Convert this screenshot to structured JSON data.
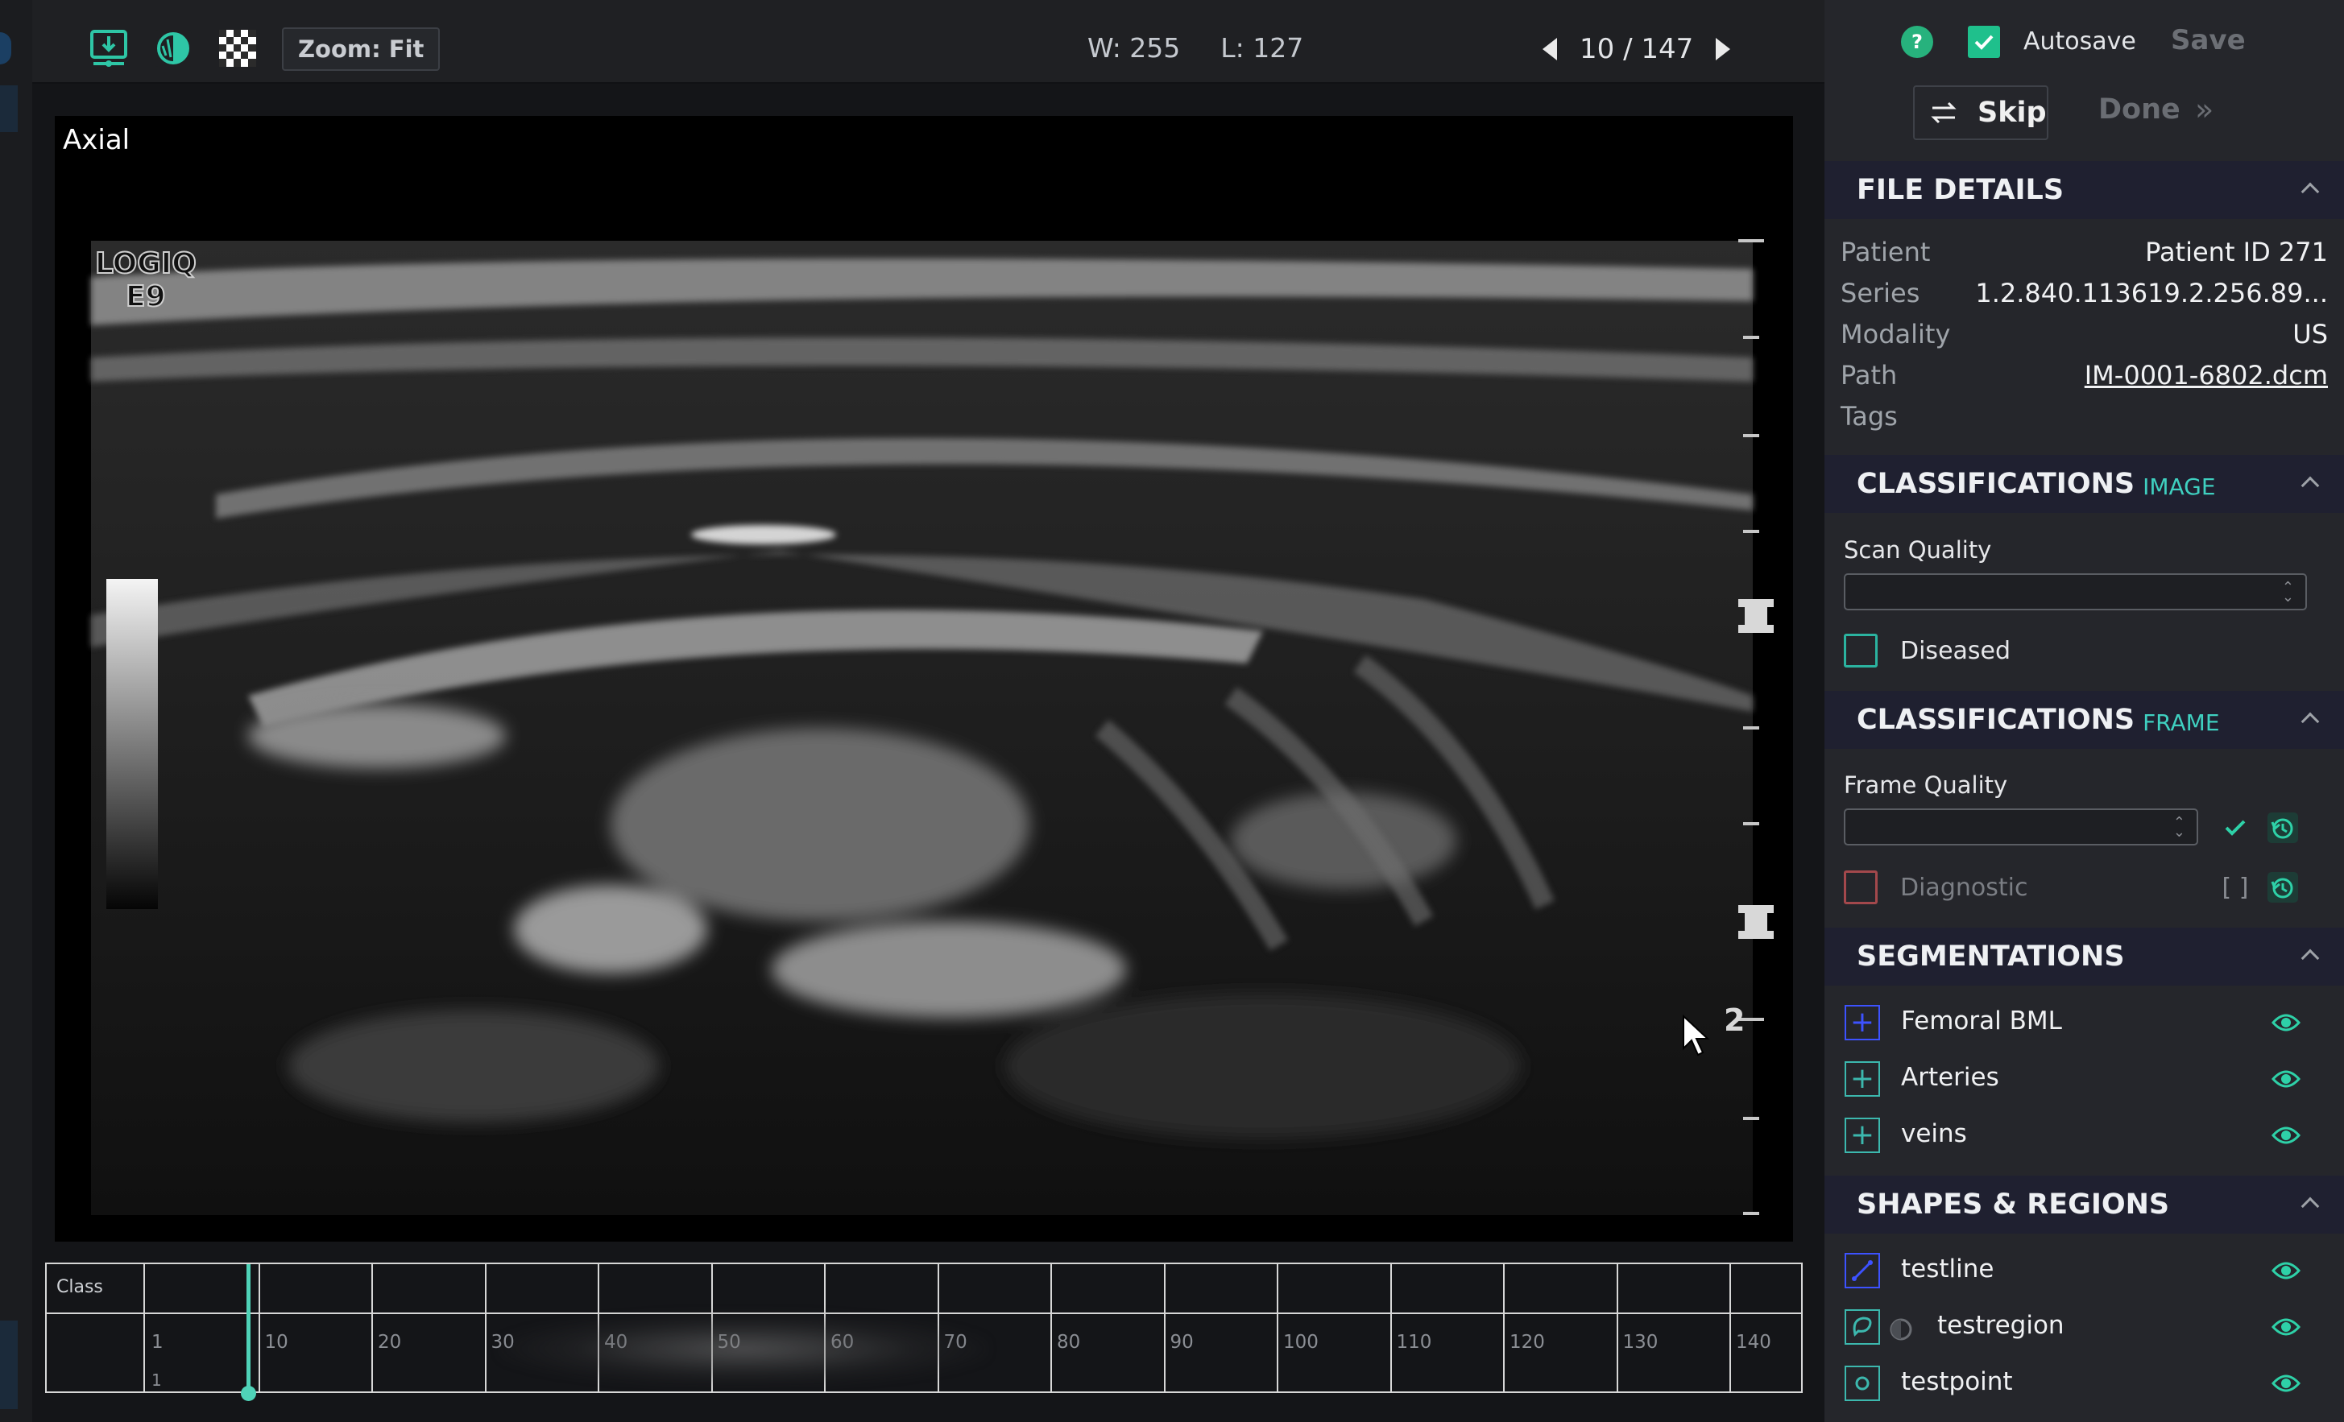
{
  "toolbar": {
    "zoom_label": "Zoom: Fit",
    "window": "W: 255",
    "level": "L: 127",
    "frame_counter": "10 / 147"
  },
  "viewer": {
    "orientation_label": "Axial",
    "device_label_line1": "LOGIQ",
    "device_label_line2": "E9",
    "depth_marker": "2"
  },
  "timeline": {
    "class_label": "Class",
    "tick_numbers": [
      "1",
      "10",
      "20",
      "30",
      "40",
      "50",
      "60",
      "70",
      "80",
      "90",
      "100",
      "110",
      "120",
      "130",
      "140"
    ],
    "first_frame_label": "1",
    "current_frame": 10
  },
  "panel": {
    "help_label": "?",
    "autosave_label": "Autosave",
    "autosave_checked": true,
    "save_label": "Save",
    "skip_label": "Skip",
    "done_label": "Done",
    "file_details": {
      "title": "FILE DETAILS",
      "rows": [
        {
          "key": "Patient",
          "value": "Patient ID 271"
        },
        {
          "key": "Series",
          "value": "1.2.840.113619.2.256.89..."
        },
        {
          "key": "Modality",
          "value": "US"
        },
        {
          "key": "Path",
          "value": "IM-0001-6802.dcm"
        },
        {
          "key": "Tags",
          "value": ""
        }
      ]
    },
    "classifications_image": {
      "title": "CLASSIFICATIONS",
      "subtitle": "IMAGE",
      "scan_quality_label": "Scan Quality",
      "scan_quality_value": "",
      "diseased_label": "Diseased"
    },
    "classifications_frame": {
      "title": "CLASSIFICATIONS",
      "subtitle": "FRAME",
      "frame_quality_label": "Frame Quality",
      "frame_quality_value": "",
      "diagnostic_label": "Diagnostic"
    },
    "segmentations": {
      "title": "SEGMENTATIONS",
      "items": [
        {
          "label": "Femoral BML",
          "color": "#3d52ff"
        },
        {
          "label": "Arteries",
          "color": "#3cb8ae"
        },
        {
          "label": "veins",
          "color": "#3cb8ae"
        }
      ]
    },
    "shapes": {
      "title": "SHAPES & REGIONS",
      "items": [
        {
          "label": "testline",
          "icon": "line-icon"
        },
        {
          "label": "testregion",
          "icon": "region-icon"
        },
        {
          "label": "testpoint",
          "icon": "point-icon"
        }
      ]
    }
  },
  "colors": {
    "accent": "#3fd0c0",
    "brand_green": "#1fc08c",
    "segment_blue": "#3d52ff",
    "eye": "#2ed1a8"
  }
}
